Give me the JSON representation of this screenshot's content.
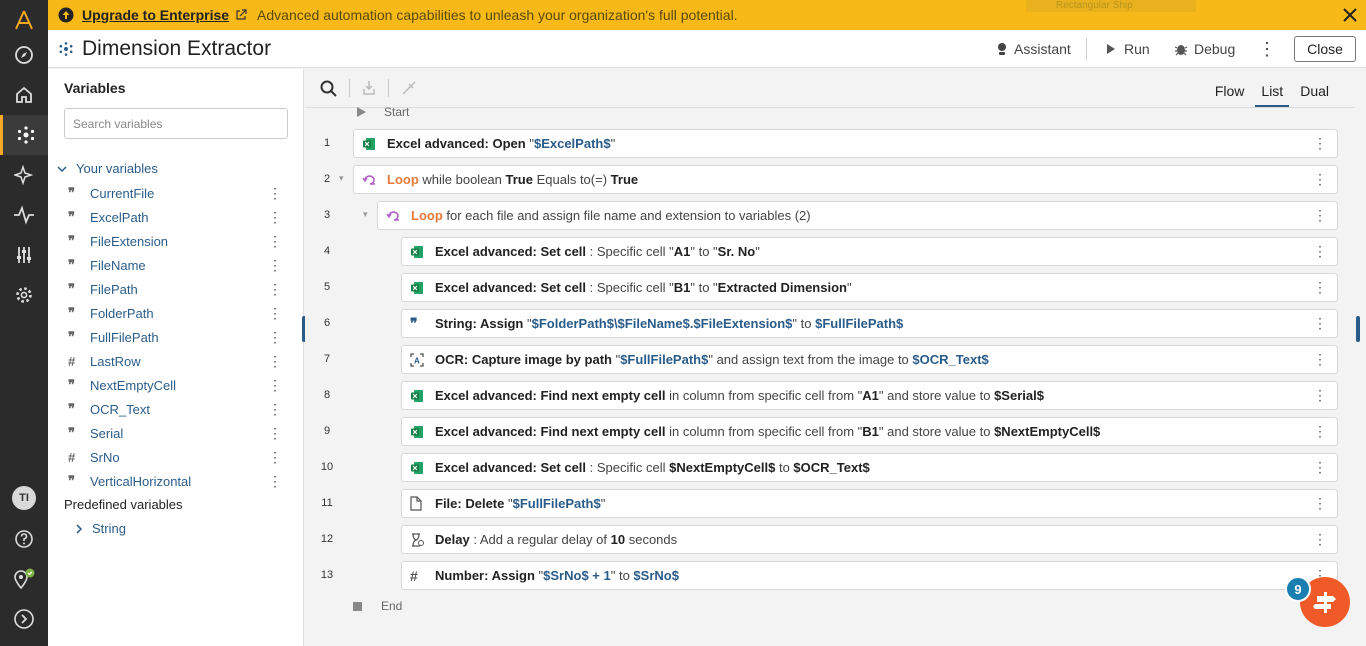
{
  "banner": {
    "link": "Upgrade to Enterprise",
    "text": "Advanced automation capabilities to unleash your organization's full potential.",
    "ghost": "Rectangular Ship"
  },
  "title": "Dimension Extractor",
  "toolbar": {
    "assistant": "Assistant",
    "run": "Run",
    "debug": "Debug",
    "close": "Close"
  },
  "rail": {
    "avatar": "TI"
  },
  "sidebar": {
    "heading": "Variables",
    "search_placeholder": "Search variables",
    "group": "Your variables",
    "variables": [
      {
        "name": "CurrentFile",
        "type": "text"
      },
      {
        "name": "ExcelPath",
        "type": "text"
      },
      {
        "name": "FileExtension",
        "type": "text"
      },
      {
        "name": "FileName",
        "type": "text"
      },
      {
        "name": "FilePath",
        "type": "text"
      },
      {
        "name": "FolderPath",
        "type": "text"
      },
      {
        "name": "FullFilePath",
        "type": "text"
      },
      {
        "name": "LastRow",
        "type": "number"
      },
      {
        "name": "NextEmptyCell",
        "type": "text"
      },
      {
        "name": "OCR_Text",
        "type": "text"
      },
      {
        "name": "Serial",
        "type": "text"
      },
      {
        "name": "SrNo",
        "type": "number"
      },
      {
        "name": "VerticalHorizontal",
        "type": "text"
      }
    ],
    "predefined": "Predefined variables",
    "predefined_item": "String"
  },
  "view_tabs": [
    "Flow",
    "List",
    "Dual"
  ],
  "view_selected": "List",
  "flow": {
    "start": "Start",
    "end": "End",
    "steps": [
      {
        "n": "1",
        "icon": "excel",
        "indent": 0,
        "parts": [
          [
            "b",
            "Excel advanced: Open "
          ],
          [
            "t",
            "\""
          ],
          [
            "v",
            "$ExcelPath$"
          ],
          [
            "t",
            "\""
          ]
        ]
      },
      {
        "n": "2",
        "icon": "loop",
        "indent": 0,
        "collapsible": true,
        "parts": [
          [
            "lp",
            "Loop"
          ],
          [
            "t",
            " while boolean "
          ],
          [
            "b",
            "True"
          ],
          [
            "t",
            " Equals to(=) "
          ],
          [
            "b",
            "True"
          ]
        ]
      },
      {
        "n": "3",
        "icon": "loop",
        "indent": 1,
        "collapsible": true,
        "parts": [
          [
            "lp",
            "Loop"
          ],
          [
            "t",
            " for each file and assign file name and extension to variables (2)"
          ]
        ]
      },
      {
        "n": "4",
        "icon": "excel",
        "indent": 2,
        "parts": [
          [
            "b",
            "Excel advanced: Set cell"
          ],
          [
            "t",
            " : Specific cell \""
          ],
          [
            "b",
            "A1"
          ],
          [
            "t",
            "\" to \""
          ],
          [
            "b",
            "Sr. No"
          ],
          [
            "t",
            "\""
          ]
        ]
      },
      {
        "n": "5",
        "icon": "excel",
        "indent": 2,
        "parts": [
          [
            "b",
            "Excel advanced: Set cell"
          ],
          [
            "t",
            " : Specific cell \""
          ],
          [
            "b",
            "B1"
          ],
          [
            "t",
            "\" to \""
          ],
          [
            "b",
            "Extracted Dimension"
          ],
          [
            "t",
            "\""
          ]
        ]
      },
      {
        "n": "6",
        "icon": "string",
        "indent": 2,
        "parts": [
          [
            "b",
            "String: Assign "
          ],
          [
            "t",
            "\""
          ],
          [
            "v",
            "$FolderPath$\\$FileName$.$FileExtension$"
          ],
          [
            "t",
            "\" to "
          ],
          [
            "v",
            "$FullFilePath$"
          ]
        ]
      },
      {
        "n": "7",
        "icon": "ocr",
        "indent": 2,
        "parts": [
          [
            "b",
            "OCR: Capture image by path "
          ],
          [
            "t",
            "\""
          ],
          [
            "v",
            "$FullFilePath$"
          ],
          [
            "t",
            "\" and assign text from the image to "
          ],
          [
            "v",
            "$OCR_Text$"
          ]
        ]
      },
      {
        "n": "8",
        "icon": "excel",
        "indent": 2,
        "parts": [
          [
            "b",
            "Excel advanced: Find next empty cell"
          ],
          [
            "t",
            " in column from specific cell from \""
          ],
          [
            "b",
            "A1"
          ],
          [
            "t",
            "\" and store value to "
          ],
          [
            "b",
            "$Serial$"
          ]
        ]
      },
      {
        "n": "9",
        "icon": "excel",
        "indent": 2,
        "parts": [
          [
            "b",
            "Excel advanced: Find next empty cell"
          ],
          [
            "t",
            " in column from specific cell from \""
          ],
          [
            "b",
            "B1"
          ],
          [
            "t",
            "\" and store value to "
          ],
          [
            "b",
            "$NextEmptyCell$"
          ]
        ]
      },
      {
        "n": "10",
        "icon": "excel",
        "indent": 2,
        "parts": [
          [
            "b",
            "Excel advanced: Set cell"
          ],
          [
            "t",
            " : Specific cell "
          ],
          [
            "b",
            "$NextEmptyCell$"
          ],
          [
            "t",
            " to "
          ],
          [
            "b",
            "$OCR_Text$"
          ]
        ]
      },
      {
        "n": "11",
        "icon": "file",
        "indent": 2,
        "parts": [
          [
            "b",
            "File: Delete "
          ],
          [
            "t",
            "\""
          ],
          [
            "v",
            "$FullFilePath$"
          ],
          [
            "t",
            "\""
          ]
        ]
      },
      {
        "n": "12",
        "icon": "delay",
        "indent": 2,
        "parts": [
          [
            "b",
            "Delay"
          ],
          [
            "t",
            " : Add a regular delay of "
          ],
          [
            "b",
            "10"
          ],
          [
            "t",
            " seconds"
          ]
        ]
      },
      {
        "n": "13",
        "icon": "number",
        "indent": 2,
        "parts": [
          [
            "b",
            "Number: Assign "
          ],
          [
            "t",
            "\""
          ],
          [
            "v",
            "$SrNo$ + 1"
          ],
          [
            "t",
            "\" to "
          ],
          [
            "v",
            "$SrNo$"
          ]
        ]
      }
    ]
  },
  "bot_badge": "9"
}
